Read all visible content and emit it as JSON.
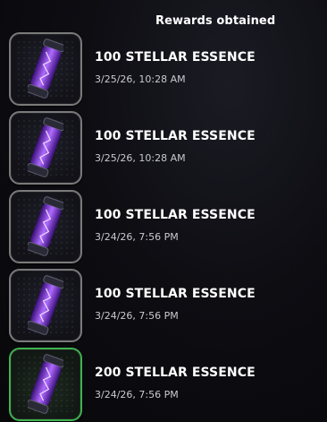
{
  "header": {
    "title": "Rewards obtained"
  },
  "rewards": [
    {
      "name": "100 STELLAR ESSENCE",
      "timestamp": "3/25/26, 10:28 AM",
      "frame": "gray",
      "icon": "stellar-essence-canister-icon"
    },
    {
      "name": "100 STELLAR ESSENCE",
      "timestamp": "3/25/26, 10:28 AM",
      "frame": "gray",
      "icon": "stellar-essence-canister-icon"
    },
    {
      "name": "100 STELLAR ESSENCE",
      "timestamp": "3/24/26, 7:56 PM",
      "frame": "gray",
      "icon": "stellar-essence-canister-icon"
    },
    {
      "name": "100 STELLAR ESSENCE",
      "timestamp": "3/24/26, 7:56 PM",
      "frame": "gray",
      "icon": "stellar-essence-canister-icon"
    },
    {
      "name": "200 STELLAR ESSENCE",
      "timestamp": "3/24/26, 7:56 PM",
      "frame": "green",
      "icon": "stellar-essence-canister-icon"
    }
  ],
  "colors": {
    "frame_gray": "#7a7a7a",
    "frame_green": "#3fb24f",
    "essence_purple": "#8a3cff"
  }
}
